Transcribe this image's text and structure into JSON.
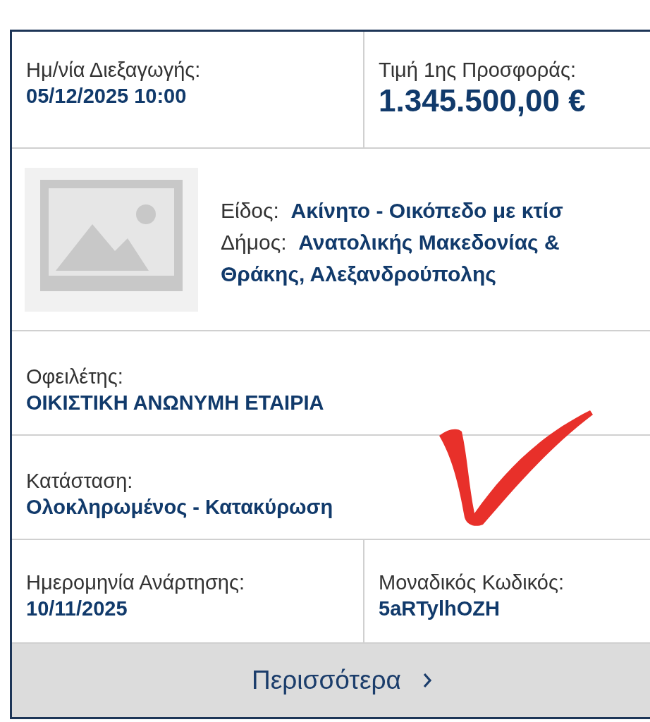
{
  "auction": {
    "date_label": "Ημ/νία Διεξαγωγής:",
    "date": "05/12/2025 10:00",
    "price_label": "Τιμή 1ης Προσφοράς:",
    "price": "1.345.500,00 €"
  },
  "property": {
    "fields": [
      {
        "label": "Είδος:",
        "value": "Ακίνητο - Οικόπεδο με κτίσ"
      },
      {
        "label": "Δήμος:",
        "value": "Ανατολικής Μακεδονίας & Θράκης, Αλεξανδρούπολης"
      }
    ]
  },
  "debtor": {
    "label": "Οφειλέτης:",
    "value": "ΟΙΚΙΣΤΙΚΗ ΑΝΩΝΥΜΗ ΕΤΑΙΡΙΑ"
  },
  "status": {
    "label": "Κατάσταση:",
    "value": "Ολοκληρωμένος - Κατακύρωση"
  },
  "posted": {
    "label": "Ημερομηνία Ανάρτησης:",
    "value": "10/11/2025"
  },
  "code": {
    "label": "Μοναδικός Κωδικός:",
    "value": "5aRTylhOZH"
  },
  "more_button": "Περισσότερα"
}
